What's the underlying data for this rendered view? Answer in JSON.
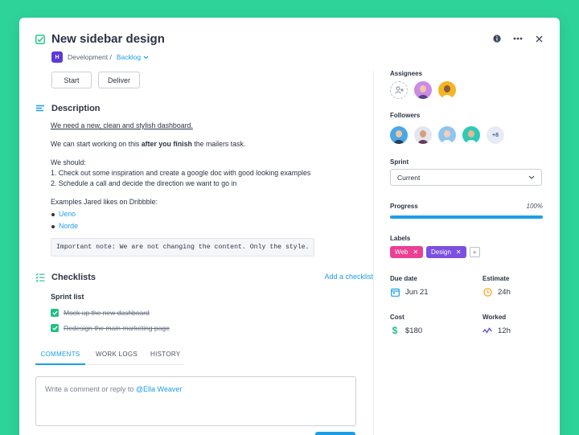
{
  "task": {
    "title": "New sidebar design",
    "project_badge": "H",
    "breadcrumb_project": "Development /",
    "breadcrumb_status": "Backlog"
  },
  "actions": {
    "start": "Start",
    "deliver": "Deliver"
  },
  "description": {
    "heading": "Description",
    "line1": "We need a new, clean and stylish dashboard.",
    "line2_pre": "We can start working on this ",
    "line2_bold": "after you finish",
    "line2_post": " the mailers task.",
    "we_should": "We should:",
    "step1": "1. Check out some inspiration and create a google doc with good looking examples",
    "step2": "2. Schedule a call and decide the direction we want to go in",
    "examples_label": "Examples Jared likes on Dribbble:",
    "examples": [
      "Ueno",
      "Norde"
    ],
    "note": "Important note: We are not changing the content. Only the style."
  },
  "checklists": {
    "heading": "Checklists",
    "add_label": "Add a checklist",
    "list_title": "Sprint list",
    "items": [
      "Mock up the new dashboard",
      "Redesign the main marketing page"
    ]
  },
  "tabs": [
    "COMMENTS",
    "WORK LOGS",
    "HISTORY"
  ],
  "comment": {
    "placeholder": "Write a comment or reply to ",
    "mention": "@Ella Weaver"
  },
  "sidebar": {
    "assignees_label": "Assignees",
    "followers_label": "Followers",
    "followers_more": "+8",
    "sprint_label": "Sprint",
    "sprint_value": "Current",
    "progress_label": "Progress",
    "progress_value": "100%",
    "progress_fraction": 1.0,
    "labels_label": "Labels",
    "labels": [
      {
        "name": "Web",
        "color": "#ec3f94"
      },
      {
        "name": "Design",
        "color": "#7b4fe0"
      }
    ],
    "due_label": "Due date",
    "due_value": "Jun 21",
    "estimate_label": "Estimate",
    "estimate_value": "24h",
    "cost_label": "Cost",
    "cost_value": "$180",
    "worked_label": "Worked",
    "worked_value": "12h"
  },
  "colors": {
    "accent": "#1a9fe6",
    "background": "#2ed39a",
    "check": "#20c184"
  }
}
